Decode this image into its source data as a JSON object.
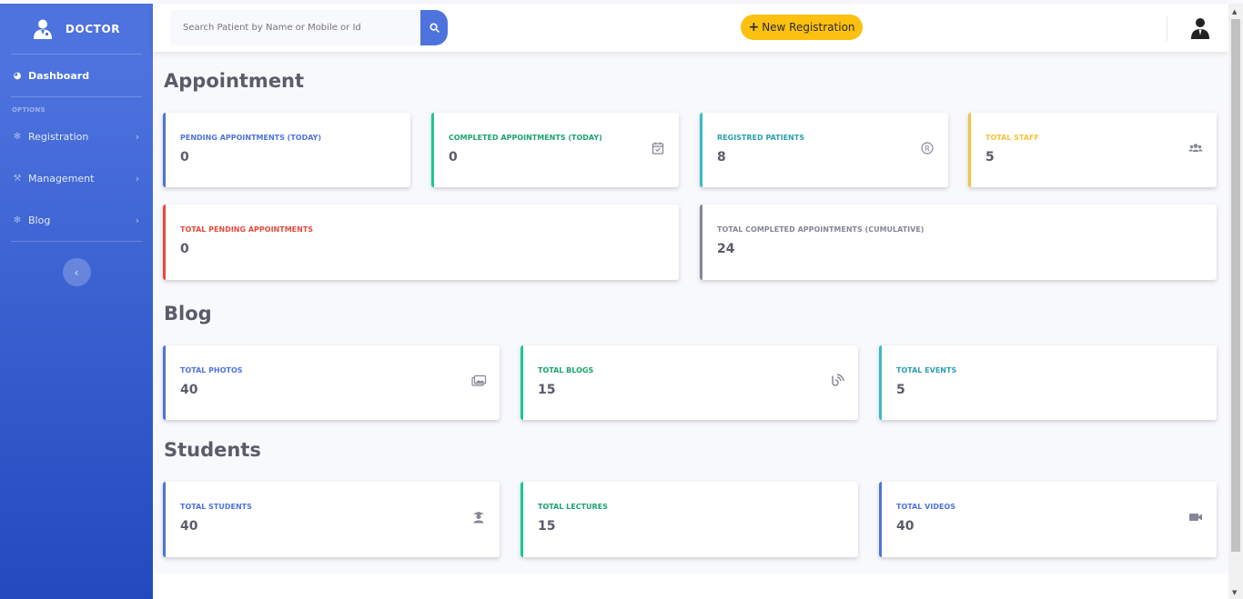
{
  "brand": {
    "name": "DOCTOR",
    "icon": "doctor-icon"
  },
  "sidebar": {
    "dashboard": {
      "label": "Dashboard",
      "icon": "dashboard-icon"
    },
    "heading": "OPTIONS",
    "items": [
      {
        "label": "Registration",
        "icon": "cog-icon"
      },
      {
        "label": "Management",
        "icon": "wrench-icon"
      },
      {
        "label": "Blog",
        "icon": "cog-icon"
      }
    ],
    "toggle_icon": "chevron-left-icon"
  },
  "topbar": {
    "search_placeholder": "Search Patient by Name or Mobile or Id",
    "new_registration": "New Registration"
  },
  "sections": {
    "appointment": "Appointment",
    "blog": "Blog",
    "students": "Students"
  },
  "cards": {
    "pending_today": {
      "label": "PENDING APPOINTMENTS (TODAY)",
      "value": "0"
    },
    "completed_today": {
      "label": "COMPLETED APPOINTMENTS (TODAY)",
      "value": "0",
      "icon": "calendar-check-icon"
    },
    "registered_patients": {
      "label": "REGISTRED PATIENTS",
      "value": "8",
      "icon": "registered-icon"
    },
    "total_staff": {
      "label": "TOTAL STAFF",
      "value": "5",
      "icon": "users-icon"
    },
    "total_pending": {
      "label": "TOTAL PENDING APPOINTMENTS",
      "value": "0"
    },
    "total_completed": {
      "label": "TOTAL COMPLETED APPOINTMENTS (CUMULATIVE)",
      "value": "24"
    },
    "total_photos": {
      "label": "TOTAL PHOTOS",
      "value": "40",
      "icon": "images-icon"
    },
    "total_blogs": {
      "label": "TOTAL BLOGS",
      "value": "15",
      "icon": "blog-icon"
    },
    "total_events": {
      "label": "TOTAL EVENTS",
      "value": "5"
    },
    "total_students": {
      "label": "TOTAL STUDENTS",
      "value": "40",
      "icon": "graduate-icon"
    },
    "total_lectures": {
      "label": "TOTAL LECTURES",
      "value": "15"
    },
    "total_videos": {
      "label": "TOTAL VIDEOS",
      "value": "40",
      "icon": "video-icon"
    }
  },
  "colors": {
    "primary": "#4e73df",
    "success": "#1cc88a",
    "info": "#36b9cc",
    "warning": "#f6c23e",
    "danger": "#e74a3b",
    "secondary": "#858796",
    "accent_button": "#fbc010"
  }
}
